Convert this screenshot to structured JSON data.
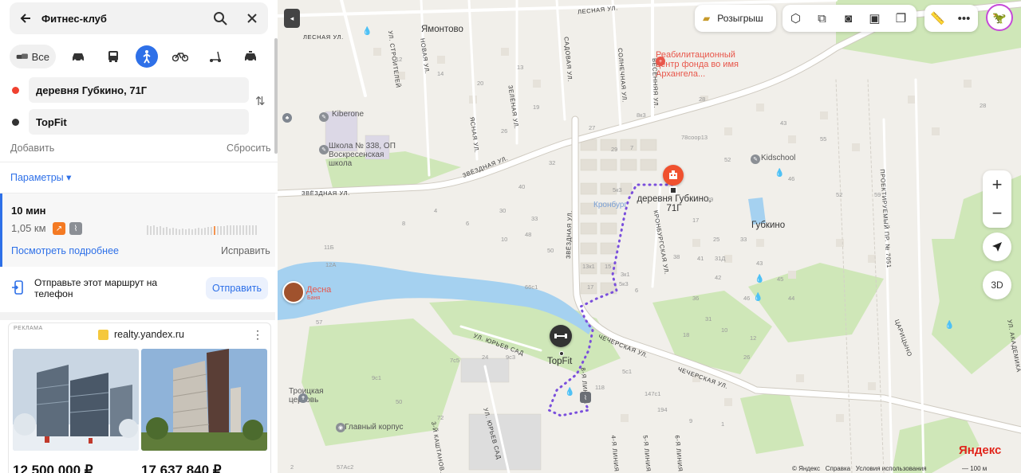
{
  "search": {
    "query": "Фитнес-клуб"
  },
  "modes": {
    "all_label": "Все"
  },
  "route_points": {
    "from": "деревня Губкино, 71Г",
    "to": "TopFit"
  },
  "actions": {
    "add": "Добавить",
    "reset": "Сбросить",
    "params": "Параметры ▾"
  },
  "route": {
    "time": "10 мин",
    "distance": "1,05 км",
    "details_link": "Посмотреть подробнее",
    "fix_link": "Исправить"
  },
  "send_phone": {
    "text": "Отправьте этот маршрут на телефон",
    "button": "Отправить"
  },
  "ad": {
    "label": "РЕКЛАМА",
    "source": "realty.yandex.ru",
    "prices": [
      "12 500 000 ₽",
      "17 637 840 ₽"
    ]
  },
  "map": {
    "toolbar": {
      "raffle": "Розыгрыш"
    },
    "zoom": {
      "in": "+",
      "out": "−"
    },
    "btn_3d": "3D",
    "labels": {
      "yamontovo": "Ямонтово",
      "rehab": "Реабилитационный центр фонда во имя Архангела...",
      "kiberone": "Kiberone",
      "school": "Школа № 338, ОП Воскресенская школа",
      "kidschool": "Kidschool",
      "kronburg": "Кронбург",
      "gubkino": "Губкино",
      "desna": "Десна",
      "desna_sub": "Баня",
      "troitskaya": "Троицкая церковь",
      "main_building": "Главный корпус",
      "destination": "деревня Губкино, 71Г",
      "topfit": "TopFit"
    },
    "streets": {
      "zvezdnaya1": "ЗВЁЗДНАЯ УЛ.",
      "zvezdnaya2": "ЗВЁЗДНАЯ УЛ.",
      "zvezdnaya3": "ЗВЁЗДНАЯ УЛ.",
      "chercherskaya1": "ЧЕЧЕРСКАЯ УЛ.",
      "chercherskaya2": "ЧЕЧЕРСКАЯ УЛ.",
      "lesnaya1": "ЛЕСНАЯ УЛ.",
      "lesnaya2": "ЛЕСНАЯ УЛ.",
      "kronburg_st": "КРОНБУРГСКАЯ УЛ.",
      "yuryev": "УЛ. ЮРЬЕВ САД",
      "yuryev2": "УЛ. ЮРЬЕВ САД",
      "novaya": "НОВАЯ УЛ.",
      "stroiteley": "УЛ. СТРОИТЕЛЕЙ",
      "zelenaya": "ЗЕЛЁНАЯ УЛ.",
      "sadovaya": "САДОВАЯ УЛ.",
      "solnechnaya": "СОЛНЕЧНАЯ УЛ.",
      "vesennyaya": "ВЕСЕННЯЯ УЛ.",
      "yasnaya": "ЯСНАЯ УЛ.",
      "proektiruemy": "ПРОЕКТИРУЕМЫЙ ПР. № 7051",
      "tsaritsyno": "ЦАРИЦЫНО",
      "akademika": "УЛ. АКАДЕМИКА",
      "kashtanovo": "3-Й КАШТАНОВ...",
      "liniya4": "4-Я ЛИНИЯ",
      "liniya5": "5-Я ЛИНИЯ",
      "liniya6": "6-Я ЛИНИЯ",
      "liniya8": "8-Я ЛИНИЯ"
    },
    "house_numbers": [
      "12",
      "14",
      "20",
      "13",
      "19",
      "26",
      "32",
      "40",
      "4",
      "8",
      "6",
      "10",
      "33",
      "30",
      "48",
      "50",
      "29",
      "17",
      "25",
      "33",
      "38",
      "41",
      "42",
      "43",
      "45",
      "46",
      "44",
      "36",
      "31Д",
      "11Б",
      "12А",
      "66с1",
      "29",
      "5к3",
      "13к1",
      "15",
      "3к1",
      "17",
      "5к3",
      "6",
      "31",
      "10",
      "12",
      "18",
      "24",
      "7с5",
      "9с3",
      "5с1",
      "147с1",
      "118",
      "194",
      "9",
      "1",
      "2",
      "57Ас2",
      "57",
      "9с1",
      "50",
      "72",
      "26",
      "27",
      "8к3",
      "7",
      "78соор13",
      "28",
      "52",
      "43",
      "55",
      "46",
      "52",
      "59",
      "28",
      "11"
    ],
    "footer": {
      "copyright": "© Яндекс",
      "help": "Справка",
      "terms": "Условия использования"
    },
    "brand": "Яндекс",
    "scale": "100 м"
  }
}
